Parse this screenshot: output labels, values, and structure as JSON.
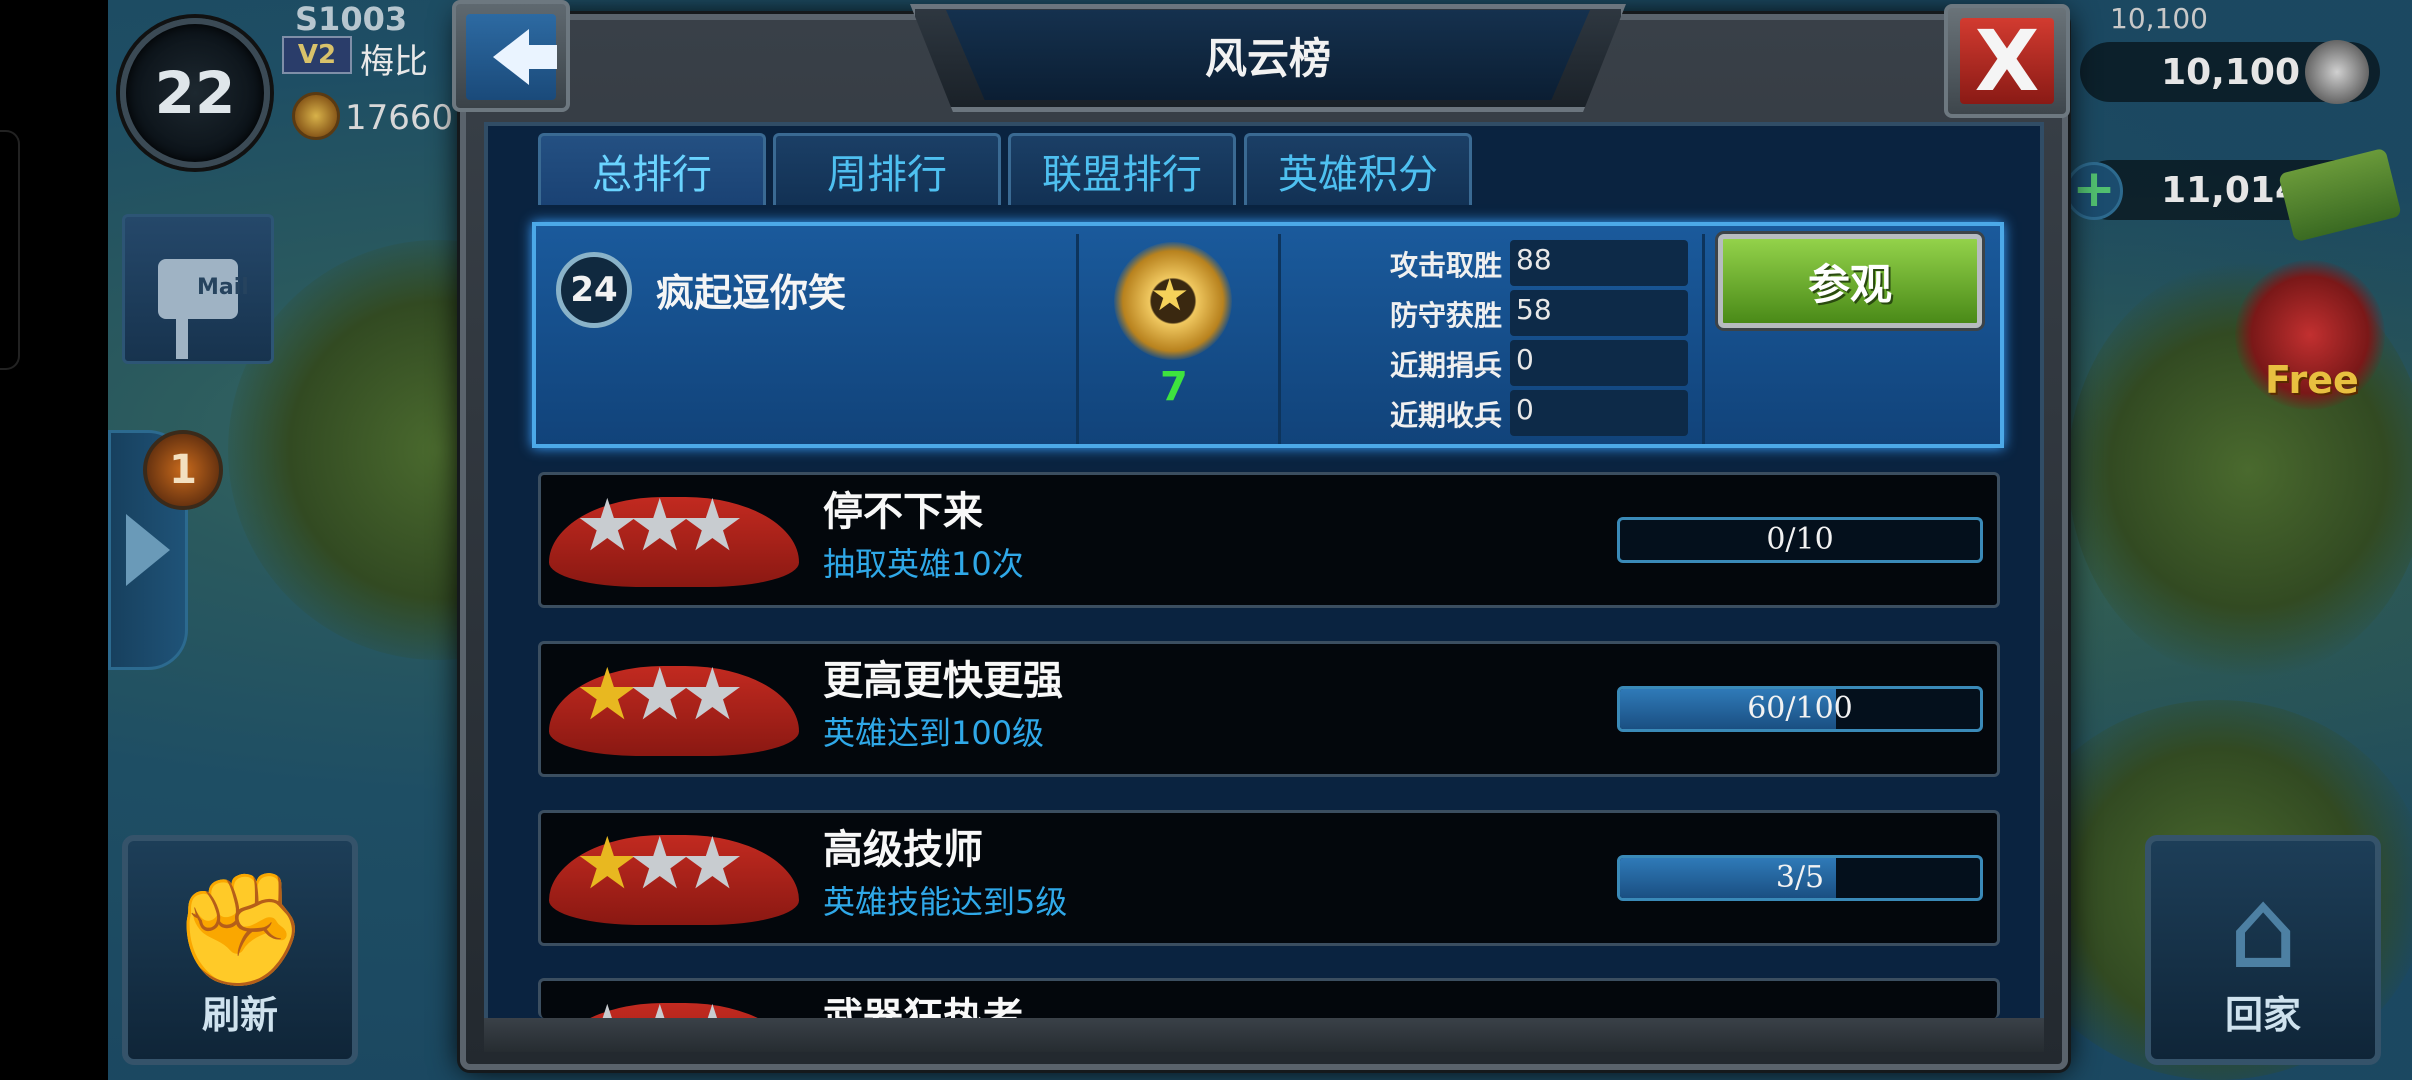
{
  "hud": {
    "level": "22",
    "vip": "V2",
    "server": "S1003",
    "player_name": "梅比",
    "power": "17660",
    "mail_label": "Mail",
    "notification_count": "1",
    "refresh_label": "刷新",
    "home_label": "回家",
    "resource_top_ghost": "10,100",
    "resource_1": "10,100",
    "resource_2": "11,014",
    "gift_label": "Free"
  },
  "dialog": {
    "title": "风云榜",
    "close_label": "X",
    "tabs": [
      {
        "label": "总排行"
      },
      {
        "label": "周排行"
      },
      {
        "label": "联盟排行"
      },
      {
        "label": "英雄积分"
      }
    ]
  },
  "player_card": {
    "rank": "24",
    "name": "疯起逗你笑",
    "medal_count": "7",
    "stats": [
      {
        "label": "攻击取胜",
        "value": "88"
      },
      {
        "label": "防守获胜",
        "value": "58"
      },
      {
        "label": "近期捐兵",
        "value": "0"
      },
      {
        "label": "近期收兵",
        "value": "0"
      }
    ],
    "visit_label": "参观"
  },
  "achievements": [
    {
      "title": "停不下来",
      "desc": "抽取英雄10次",
      "progress": "0/10",
      "fraction": 0.0,
      "gold_stars": 0
    },
    {
      "title": "更高更快更强",
      "desc": "英雄达到100级",
      "progress": "60/100",
      "fraction": 0.6,
      "gold_stars": 1
    },
    {
      "title": "高级技师",
      "desc": "英雄技能达到5级",
      "progress": "3/5",
      "fraction": 0.6,
      "gold_stars": 1
    },
    {
      "title": "武器狂热者",
      "desc": "",
      "progress": "",
      "fraction": 0.0,
      "gold_stars": 0
    }
  ]
}
